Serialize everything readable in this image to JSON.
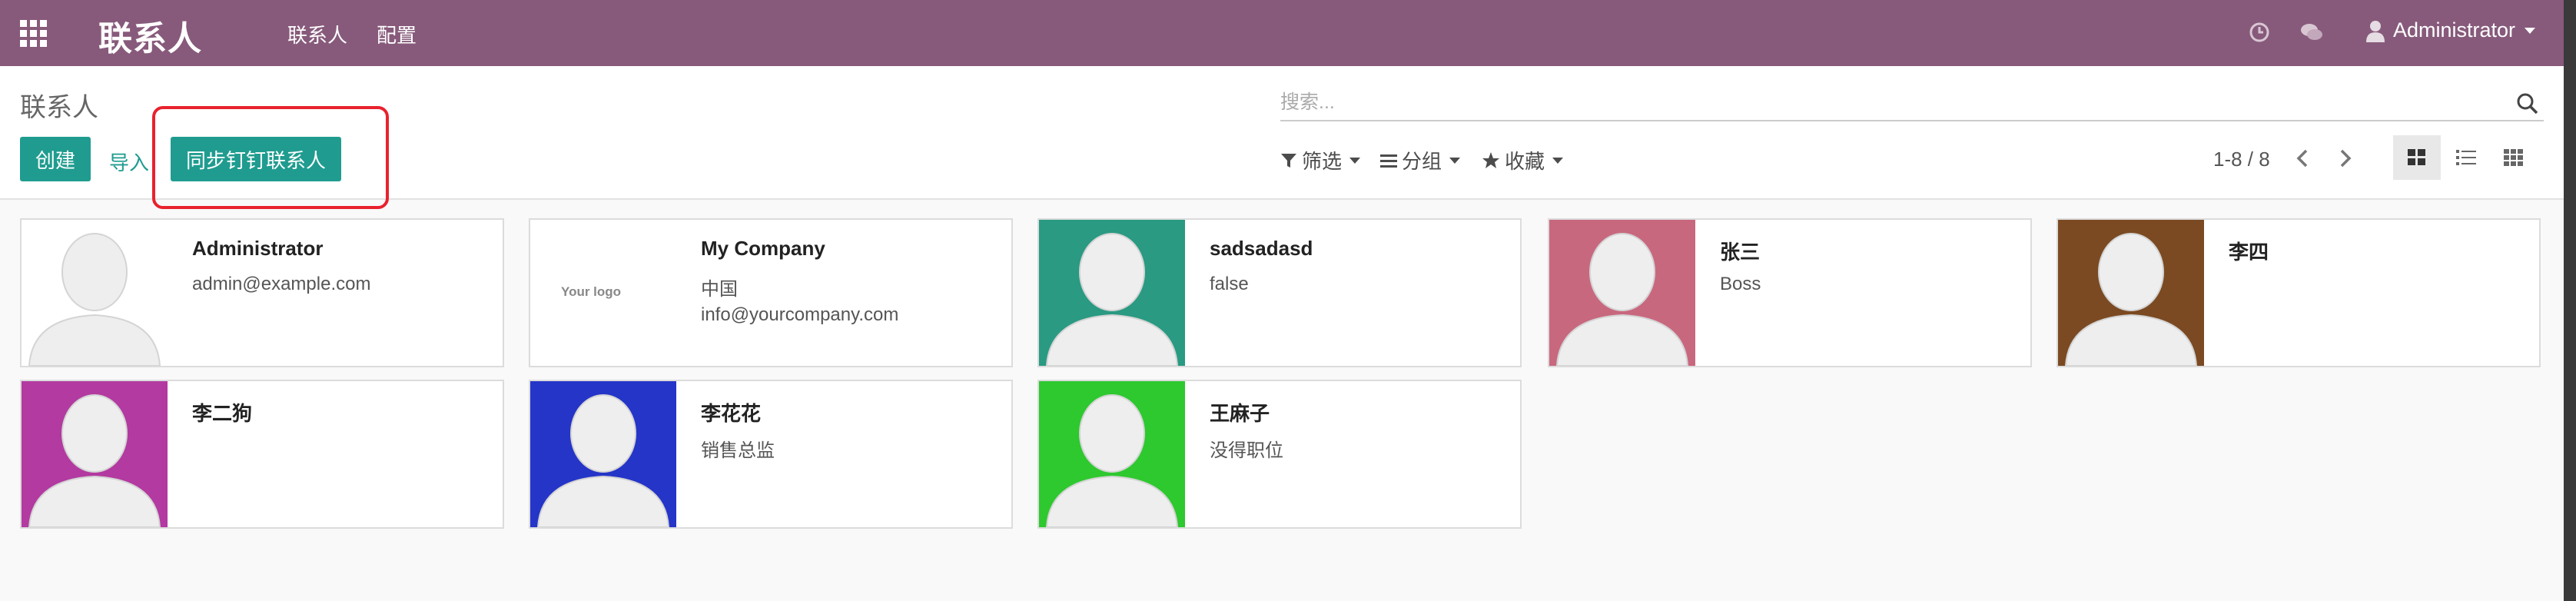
{
  "navbar": {
    "brand": "联系人",
    "menu": [
      "联系人",
      "配置"
    ],
    "user": "Administrator",
    "bg_color": "#875a7b"
  },
  "control": {
    "title": "联系人",
    "create_label": "创建",
    "import_label": "导入",
    "sync_label": "同步钉钉联系人",
    "search_placeholder": "搜索...",
    "filter_label": "筛选",
    "group_label": "分组",
    "favorites_label": "收藏",
    "pager": "1-8 / 8",
    "accent_color": "#1f9c8f",
    "highlight_color": "#e8222e"
  },
  "cards": [
    {
      "name": "Administrator",
      "line1": "admin@example.com",
      "line2": "",
      "bg": "#ffffff"
    },
    {
      "name": "My Company",
      "line1": "中国",
      "line2": "info@yourcompany.com",
      "bg": "#ffffff",
      "logo": "Your logo"
    },
    {
      "name": "sadsadasd",
      "line1": "false",
      "line2": "",
      "bg": "#2a9a82"
    },
    {
      "name": "张三",
      "line1": "Boss",
      "line2": "",
      "bg": "#c8687e"
    },
    {
      "name": "李四",
      "line1": "",
      "line2": "",
      "bg": "#7b4a22"
    },
    {
      "name": "李二狗",
      "line1": "",
      "line2": "",
      "bg": "#b23aa0"
    },
    {
      "name": "李花花",
      "line1": "销售总监",
      "line2": "",
      "bg": "#2535c8"
    },
    {
      "name": "王麻子",
      "line1": "没得职位",
      "line2": "",
      "bg": "#2ec82f"
    }
  ]
}
